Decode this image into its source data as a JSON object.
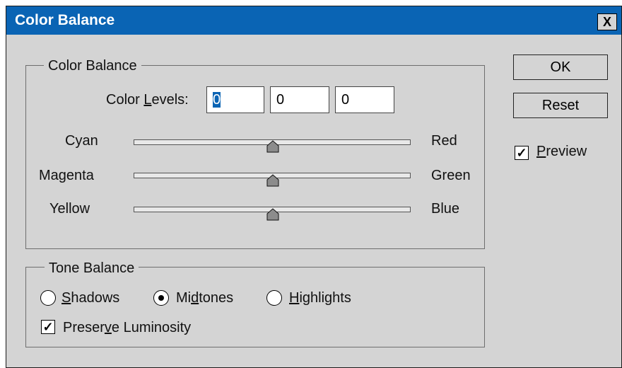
{
  "window": {
    "title": "Color Balance",
    "close_label": "X"
  },
  "color_balance": {
    "group_label": "Color Balance",
    "levels_label_prefix": "Color ",
    "levels_label_mnemonic": "L",
    "levels_label_suffix": "evels:",
    "levels": [
      "0",
      "0",
      "0"
    ],
    "sliders": [
      {
        "left": "Cyan",
        "right": "Red",
        "value": 0
      },
      {
        "left": "Magenta",
        "right": "Green",
        "value": 0
      },
      {
        "left": "Yellow",
        "right": "Blue",
        "value": 0
      }
    ]
  },
  "tone_balance": {
    "group_label": "Tone Balance",
    "shadows_mnemonic": "S",
    "shadows_rest": "hadows",
    "midtones_pre": "Mi",
    "midtones_mnemonic": "d",
    "midtones_post": "tones",
    "highlights_mnemonic": "H",
    "highlights_rest": "ighlights",
    "selected": "Midtones",
    "preserve_pre": "Preser",
    "preserve_mnemonic": "v",
    "preserve_post": "e Luminosity",
    "preserve_checked": true
  },
  "buttons": {
    "ok": "OK",
    "reset": "Reset"
  },
  "preview": {
    "mnemonic": "P",
    "rest": "review",
    "checked": true
  },
  "colors": {
    "titlebar": "#0a64b4",
    "dialog_bg": "#d4d4d4"
  }
}
